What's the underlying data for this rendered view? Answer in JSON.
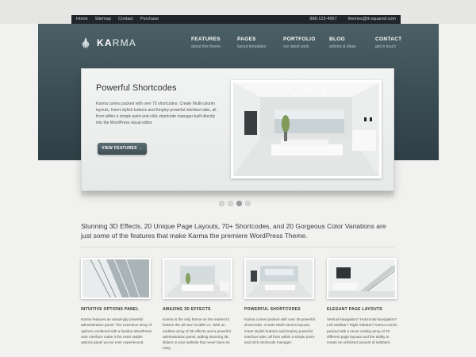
{
  "utility_bar": {
    "links": [
      "Home",
      "Sitemap",
      "Contact",
      "Purchase"
    ],
    "phone": "888-123-4567",
    "email": "themes@tt-squared.com"
  },
  "logo": {
    "text_bold": "KA",
    "text_light": "RMA"
  },
  "nav": [
    {
      "title": "FEATURES",
      "subtitle": "about this theme"
    },
    {
      "title": "PAGES",
      "subtitle": "layout templates"
    },
    {
      "title": "PORTFOLIO",
      "subtitle": "our latest work"
    },
    {
      "title": "BLOG",
      "subtitle": "articles & ideas"
    },
    {
      "title": "CONTACT",
      "subtitle": "get in touch"
    }
  ],
  "slider": {
    "title": "Powerful Shortcodes",
    "text": "Karma comes packed with over 75 shortcodes. Create Multi-column layouts, Insert stylish buttons and Employ powerful interface tabs, all from within a simple point-and-click shortcode manager built directly into the WordPress visual editor.",
    "button": "VIEW FEATURES →",
    "dots": 4,
    "active_dot": 2
  },
  "tagline": "Stunning 3D Effects, 20 Unique Page Layouts, 70+ Shortcodes, and 20 Gorgeous Color Variations are just some of the features that make Karma the premiere WordPress Theme.",
  "features": [
    {
      "title": "INTUITIVE OPTIONS PANEL",
      "text": "Karma features an amazingly powerful administration panel. The extensive array of options combined with a familiar WordPress user interface make it the most usable options panel you've ever experienced."
    },
    {
      "title": "AMAZING 3D EFFECTS",
      "text": "Karma is the only theme on the market to feature the all new CU3ER v1. With an endless array of 3D effects and a powerful administration panel, adding stunning 3D sliders to your website has never been so easy."
    },
    {
      "title": "POWERFUL SHORTCODES",
      "text": "Karma comes packed with over 40 powerful shortcodes. Create Multi-column layouts, Insert stylish buttons and Employ powerful interface tabs, all from within a simple point-and-click shortcode manager."
    },
    {
      "title": "ELEGANT PAGE LAYOUTS",
      "text": "Vertical Navigation? Horizontal Navigation? Left Sidebar? Right Sidebar? Karma comes packed with a never ending array of 20 different page layouts and the ability to create an unlimited amount of sidebars."
    }
  ],
  "colors": {
    "header": "#3a4c54",
    "utility": "#1f2528",
    "page": "#f1f1ef"
  }
}
